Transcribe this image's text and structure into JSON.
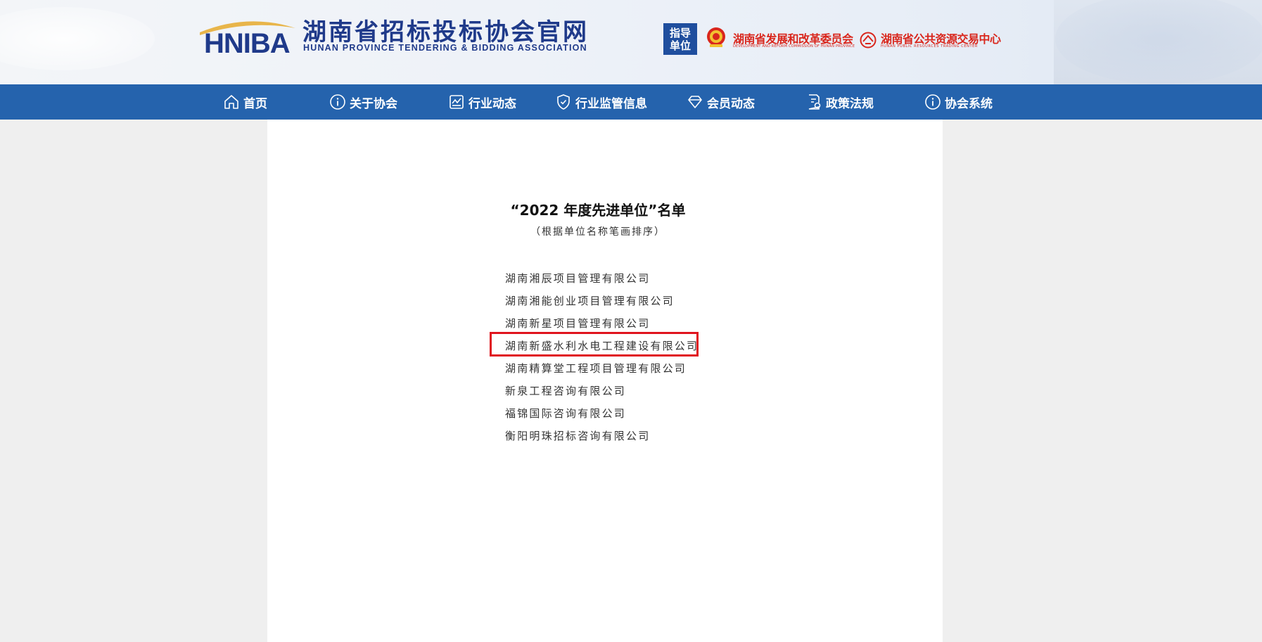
{
  "header": {
    "logo_text": "HNIBA",
    "site_title": "湖南省招标投标协会官网",
    "site_subtitle": "HUNAN PROVINCE TENDERING & BIDDING ASSOCIATION",
    "guide_badge": {
      "line1": "指导",
      "line2": "单位"
    },
    "org1_name": "湖南省发展和改革委员会",
    "org1_en": "DEVELOPMENT AND REFORM COMMISSION OF HUNAN PROVINCE",
    "org2_name": "湖南省公共资源交易中心",
    "org2_en": "HUNAN PUBLIC RESOURCES TRADING CENTER"
  },
  "nav": {
    "items": [
      {
        "label": "首页",
        "icon": "home-icon"
      },
      {
        "label": "关于协会",
        "icon": "info-icon"
      },
      {
        "label": "行业动态",
        "icon": "chart-icon"
      },
      {
        "label": "行业监管信息",
        "icon": "shield-icon"
      },
      {
        "label": "会员动态",
        "icon": "diamond-icon"
      },
      {
        "label": "政策法规",
        "icon": "document-icon"
      },
      {
        "label": "协会系统",
        "icon": "info-icon"
      }
    ]
  },
  "document": {
    "title": "“2022 年度先进单位”名单",
    "subtitle": "（根据单位名称笔画排序）",
    "companies": [
      "湖南湘辰项目管理有限公司",
      "湖南湘能创业项目管理有限公司",
      "湖南新星项目管理有限公司",
      "湖南新盛水利水电工程建设有限公司",
      "湖南精算堂工程项目管理有限公司",
      "新泉工程咨询有限公司",
      "福锦国际咨询有限公司",
      "衡阳明珠招标咨询有限公司"
    ],
    "highlighted_index": 3
  },
  "colors": {
    "brand_blue": "#1f3a8a",
    "nav_blue": "#2563ad",
    "gold": "#e8b54a",
    "red": "#d9261c",
    "highlight": "#e0141e"
  }
}
